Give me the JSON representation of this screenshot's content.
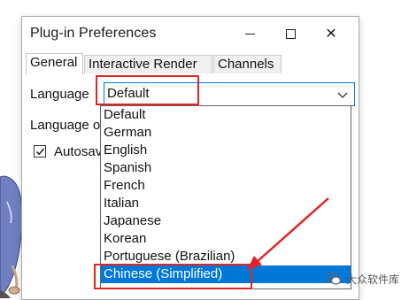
{
  "window": {
    "title": "Plug-in Preferences",
    "minimize_icon": "minimize-icon",
    "maximize_icon": "maximize-icon",
    "close_icon": "close-icon",
    "close_glyph": "✕"
  },
  "tabs": [
    {
      "label": "General",
      "active": true
    },
    {
      "label": "Interactive Render",
      "active": false
    },
    {
      "label": "Channels",
      "active": false
    }
  ],
  "general": {
    "language_label": "Language",
    "language_value": "Default",
    "language2_label": "Language o",
    "autosave_label": "Autosav",
    "autosave_checked": true
  },
  "dropdown": {
    "options": [
      "Default",
      "German",
      "English",
      "Spanish",
      "French",
      "Italian",
      "Japanese",
      "Korean",
      "Portuguese (Brazilian)",
      "Chinese (Simplified)"
    ],
    "selected": "Chinese (Simplified)"
  },
  "annotations": {
    "color": "#e02424"
  },
  "watermark": {
    "text": "大众软件库"
  }
}
